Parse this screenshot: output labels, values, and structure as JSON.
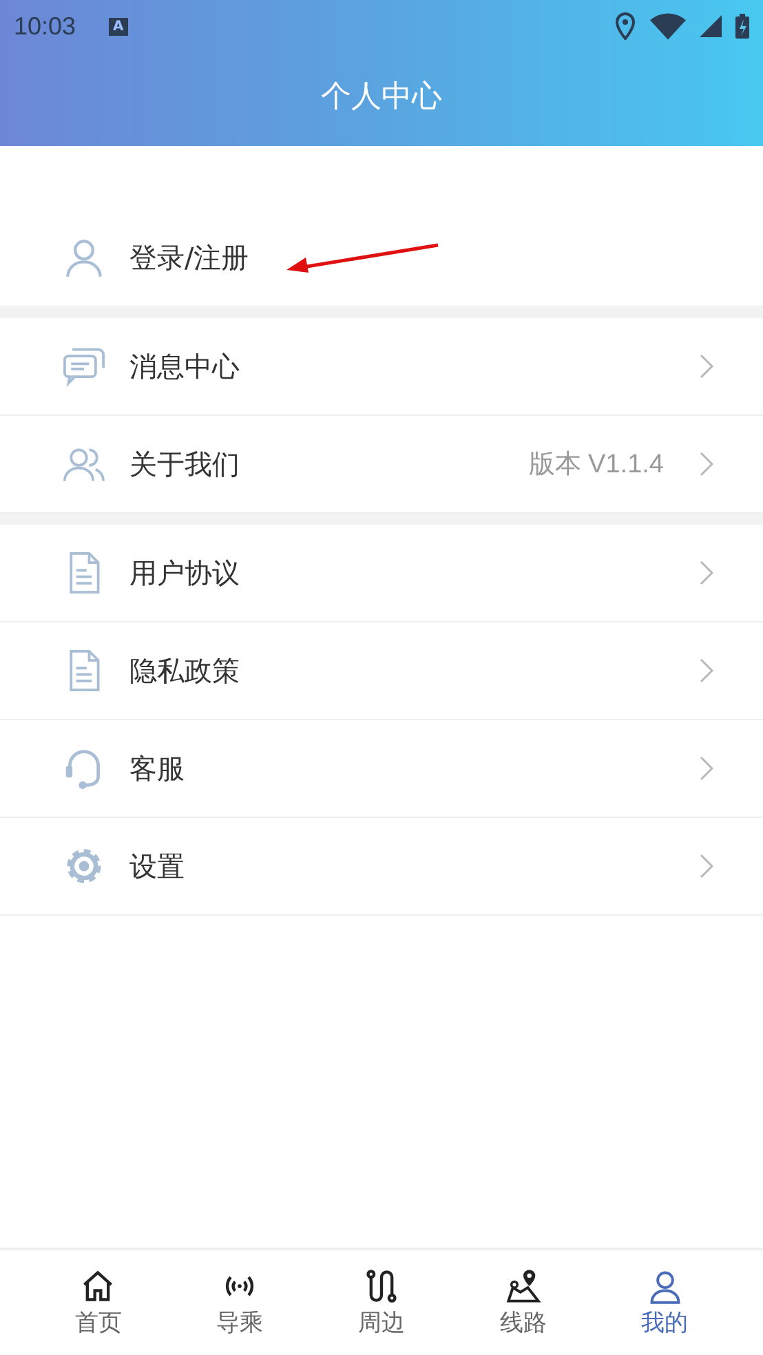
{
  "status_bar": {
    "time": "10:03",
    "badge": "A"
  },
  "header": {
    "title": "个人中心"
  },
  "login": {
    "kind": "person",
    "label": "登录/注册"
  },
  "groups": [
    {
      "items": [
        {
          "kind": "chat",
          "label": "消息中心"
        },
        {
          "kind": "people",
          "label": "关于我们",
          "value": "版本 V1.1.4"
        }
      ]
    },
    {
      "items": [
        {
          "kind": "document",
          "label": "用户协议"
        },
        {
          "kind": "document",
          "label": "隐私政策"
        },
        {
          "kind": "headset",
          "label": "客服"
        },
        {
          "kind": "gear",
          "label": "设置"
        }
      ]
    }
  ],
  "tab_bar": [
    {
      "kind": "home",
      "label": "首页",
      "selected": false
    },
    {
      "kind": "signal",
      "label": "导乘",
      "selected": false
    },
    {
      "kind": "route",
      "label": "周边",
      "selected": false
    },
    {
      "kind": "map",
      "label": "线路",
      "selected": false
    },
    {
      "kind": "person",
      "label": "我的",
      "selected": true
    }
  ]
}
